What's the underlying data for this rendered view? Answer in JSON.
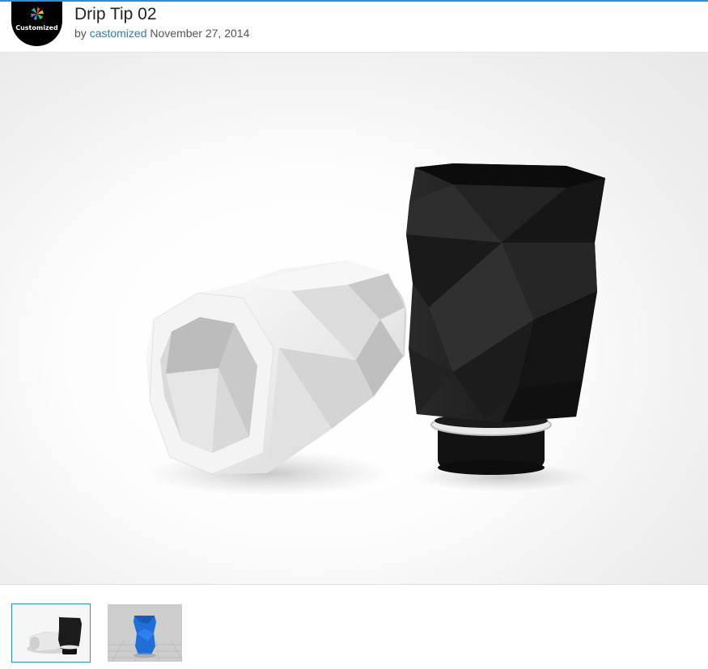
{
  "header": {
    "avatar_text": "Customized",
    "title": "Drip Tip 02",
    "by_label": "by",
    "author": "castomized",
    "date": "November 27, 2014"
  },
  "colors": {
    "accent": "#2b8fd9",
    "link": "#2a7bbf",
    "avatar_bg": "#000000",
    "object_black": "#1a1a1a",
    "object_white": "#efefef",
    "object_blue": "#1f6fd6"
  },
  "gallery": {
    "thumbnails": [
      {
        "name": "thumb-white-black-tips",
        "selected": true
      },
      {
        "name": "thumb-blue-tip-render",
        "selected": false
      }
    ]
  }
}
